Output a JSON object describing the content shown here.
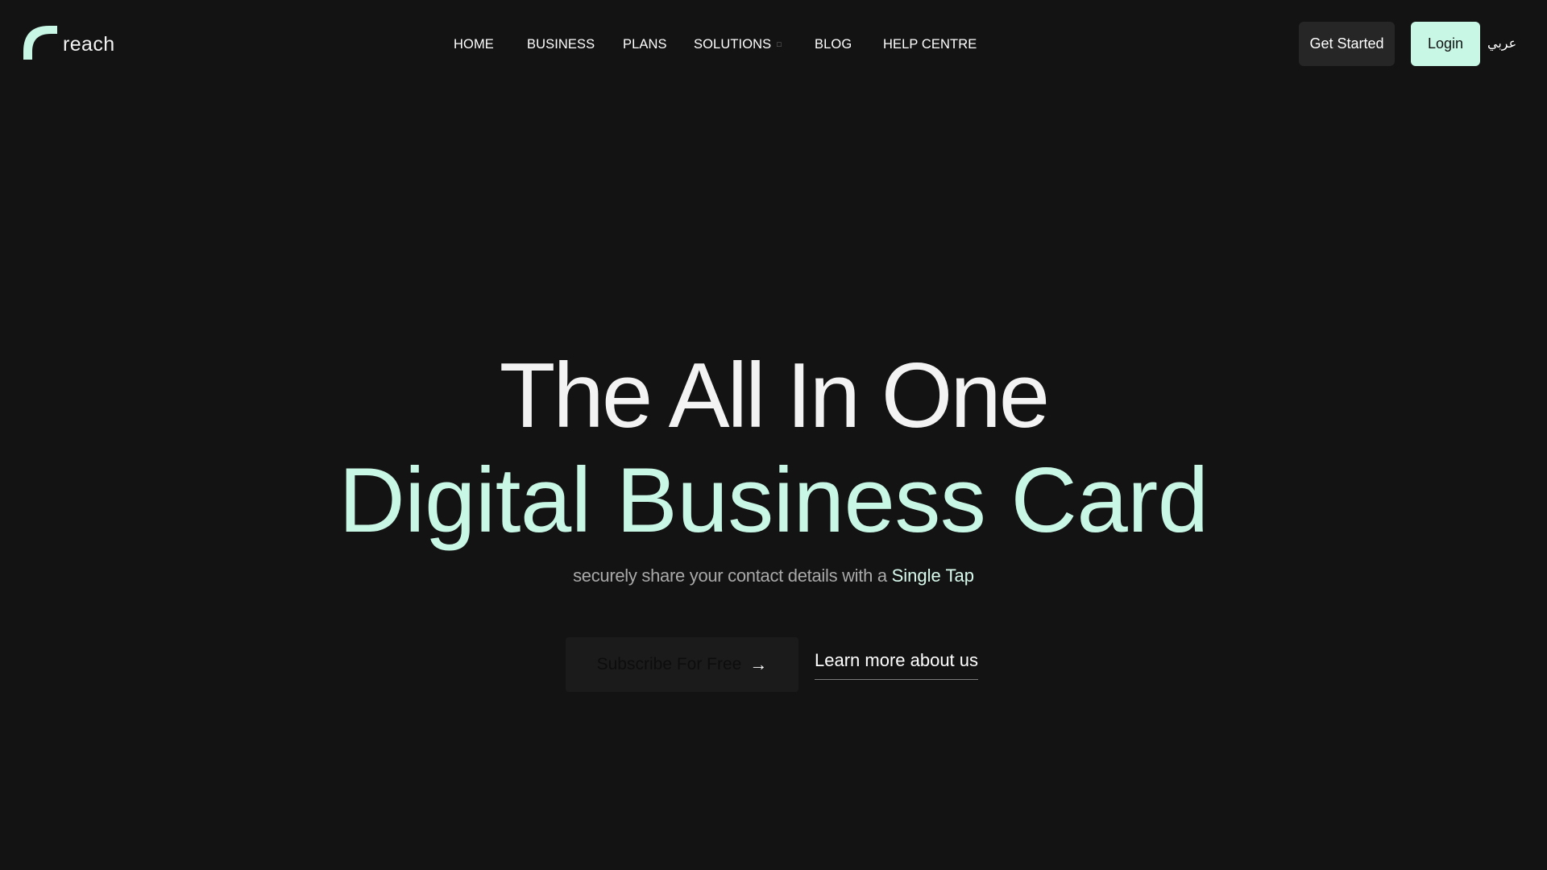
{
  "brand": {
    "name": "reach",
    "accent_color": "#c8f7e6",
    "background_color": "#131313"
  },
  "nav": {
    "items": [
      {
        "label": "HOME"
      },
      {
        "label": "BUSINESS"
      },
      {
        "label": "PLANS"
      },
      {
        "label": "SOLUTIONS",
        "has_dropdown": true,
        "dropdown_icon": "chevron-down-icon"
      },
      {
        "label": "BLOG"
      },
      {
        "label": "HELP CENTRE"
      }
    ]
  },
  "header_actions": {
    "get_started_label": "Get Started",
    "login_label": "Login",
    "language_label": "عربي"
  },
  "hero": {
    "title_line_1": "The All In One",
    "title_line_2": "Digital Business Card",
    "subtitle_prefix": "securely share your contact details with a",
    "subtitle_highlight": "Single Tap",
    "primary_cta_label": "Subscribe For Free",
    "primary_cta_icon": "arrow-right-icon",
    "secondary_cta_label": "Learn more about us"
  }
}
